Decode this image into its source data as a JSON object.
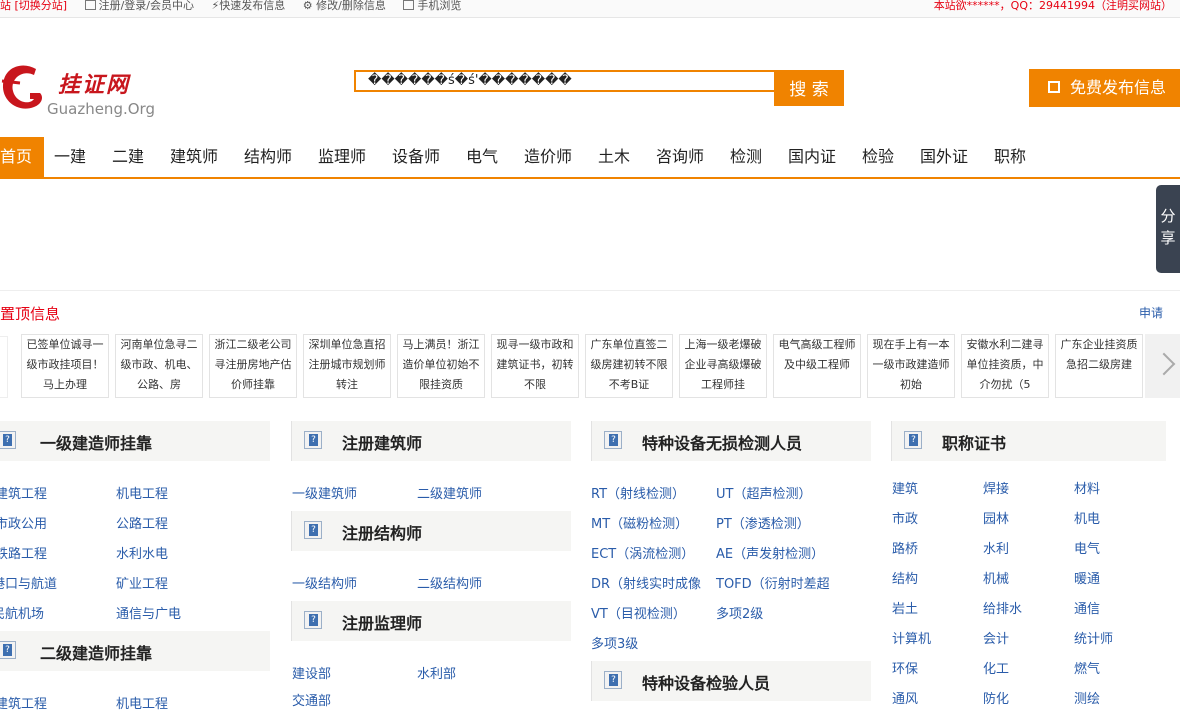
{
  "topbar": {
    "items": [
      "站 [切换分站]",
      "注册/登录/会员中心",
      "快速发布信息",
      "修改/删除信息",
      "手机浏览"
    ],
    "right": "本站欲******，QQ：29441994（注明买网站）"
  },
  "logo": {
    "cn": "挂证网",
    "en": "Guazheng.Org"
  },
  "search": {
    "value": "������ś�ś'�������",
    "button": "搜 索"
  },
  "publish_button": "免费发布信息",
  "nav": [
    "首页",
    "一建",
    "二建",
    "建筑师",
    "结构师",
    "监理师",
    "设备师",
    "电气",
    "造价师",
    "土木",
    "咨询师",
    "检测",
    "国内证",
    "检验",
    "国外证",
    "职称"
  ],
  "share_label": "分享",
  "topinfo": {
    "title": "置顶信息",
    "apply": "申请"
  },
  "ticker": [
    "已签单位诚寻一级市政挂项目！马上办理",
    "河南单位急寻二级市政、机电、公路、房",
    "浙江二级老公司寻注册房地产估价师挂靠",
    "深圳单位急直招注册城市规划师转注",
    "马上满员！浙江造价单位初始不限挂资质",
    "现寻一级市政和建筑证书，初转不限",
    "广东单位直签二级房建初转不限不考B证",
    "上海一级老爆破企业寻高级爆破工程师挂",
    "电气高级工程师及中级工程师",
    "现在手上有一本一级市政建造师初始",
    "安徽水利二建寻单位挂资质，中介勿扰（5",
    "广东企业挂资质急招二级房建"
  ],
  "sections": {
    "yijian": {
      "title": "一级建造师挂靠",
      "links": [
        "建筑工程",
        "机电工程",
        "市政公用",
        "公路工程",
        "铁路工程",
        "水利水电",
        "港口与航道",
        "矿业工程",
        "民航机场",
        "通信与广电"
      ]
    },
    "erjian": {
      "title": "二级建造师挂靠",
      "links": [
        "建筑工程",
        "机电工程"
      ]
    },
    "jianzhu": {
      "title": "注册建筑师",
      "links": [
        "一级建筑师",
        "二级建筑师"
      ]
    },
    "jiegou": {
      "title": "注册结构师",
      "links": [
        "一级结构师",
        "二级结构师"
      ]
    },
    "jianli": {
      "title": "注册监理师",
      "links": [
        "建设部",
        "水利部",
        "交通部"
      ]
    },
    "wusun": {
      "title": "特种设备无损检测人员",
      "links": [
        "RT（射线检测）",
        "UT（超声检测）",
        "MT（磁粉检测）",
        "PT（渗透检测）",
        "ECT（涡流检测）",
        "AE（声发射检测）",
        "DR（射线实时成像",
        "TOFD（衍射时差超",
        "VT（目视检测）",
        "多项2级",
        "多项3级"
      ]
    },
    "jianyan": {
      "title": "特种设备检验人员"
    },
    "zhicheng": {
      "title": "职称证书",
      "links": [
        "建筑",
        "焊接",
        "材料",
        "市政",
        "园林",
        "机电",
        "路桥",
        "水利",
        "电气",
        "结构",
        "机械",
        "暖通",
        "岩土",
        "给排水",
        "通信",
        "计算机",
        "会计",
        "统计师",
        "环保",
        "化工",
        "燃气",
        "通风",
        "防化",
        "测绘"
      ]
    }
  },
  "colors": {
    "accent": "#f08300",
    "brand_red": "#c8161d",
    "link": "#2a5caa",
    "alert_red": "#e60012"
  }
}
